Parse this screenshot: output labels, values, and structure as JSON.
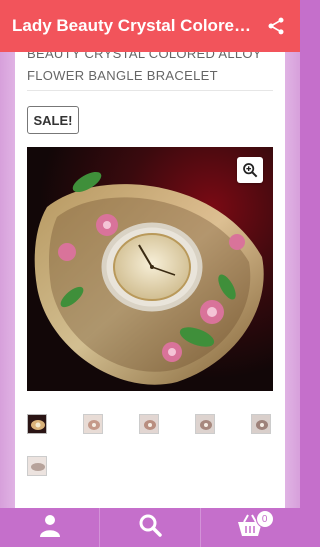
{
  "app_bar": {
    "title": "Lady Beauty Crystal Colored Alloy Flower Bangle Bracelet",
    "share_icon": "share-icon",
    "background": "#f2545b"
  },
  "product": {
    "title": "BEAUTY CRYSTAL COLORED ALLOY FLOWER BANGLE BRACELET",
    "sale_badge": "SALE!",
    "image": "crystal-flower-bangle-watch",
    "zoom_icon": "zoom-in-icon",
    "thumbnails": [
      {
        "name": "thumbnail-1",
        "selected": true
      },
      {
        "name": "thumbnail-2",
        "selected": false
      },
      {
        "name": "thumbnail-3",
        "selected": false
      },
      {
        "name": "thumbnail-4",
        "selected": false
      },
      {
        "name": "thumbnail-5",
        "selected": false
      },
      {
        "name": "thumbnail-6",
        "selected": false
      }
    ]
  },
  "bottom_nav": {
    "background": "#c56fcb",
    "items": [
      {
        "name": "account",
        "icon": "user-icon"
      },
      {
        "name": "search",
        "icon": "search-icon"
      },
      {
        "name": "cart",
        "icon": "cart-icon",
        "badge": "0"
      }
    ]
  }
}
